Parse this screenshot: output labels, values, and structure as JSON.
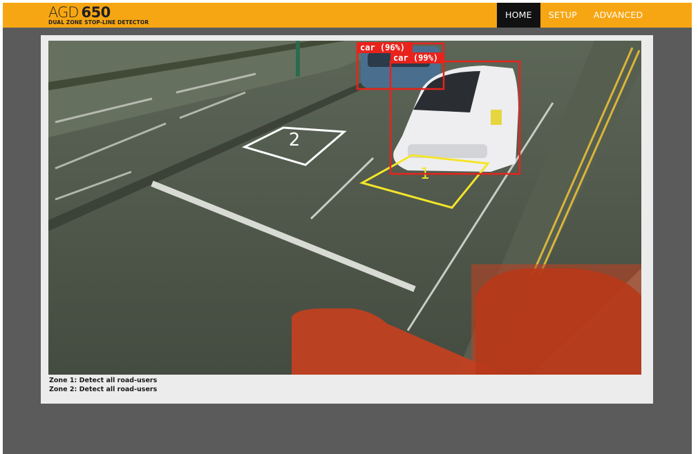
{
  "header": {
    "brand_name": "AGD",
    "brand_model": "650",
    "brand_subtitle": "DUAL ZONE STOP-LINE DETECTOR"
  },
  "nav": {
    "items": [
      {
        "label": "HOME",
        "active": true
      },
      {
        "label": "SETUP",
        "active": false
      },
      {
        "label": "ADVANCED",
        "active": false
      }
    ]
  },
  "camera": {
    "zone_labels": [
      "1",
      "2"
    ],
    "detections": [
      {
        "label": "car (96%)"
      },
      {
        "label": "car (99%)"
      }
    ]
  },
  "zones": {
    "lines": [
      "Zone 1: Detect all road-users",
      "Zone 2: Detect all road-users"
    ]
  },
  "colors": {
    "brand_orange": "#f7a613",
    "nav_active_bg": "#111111",
    "background_gray": "#5b5b5b",
    "detection_box": "#e8231c",
    "zone1_outline": "#f4e52a",
    "zone2_outline": "#ffffff",
    "mask_overlay": "#c4401f"
  }
}
